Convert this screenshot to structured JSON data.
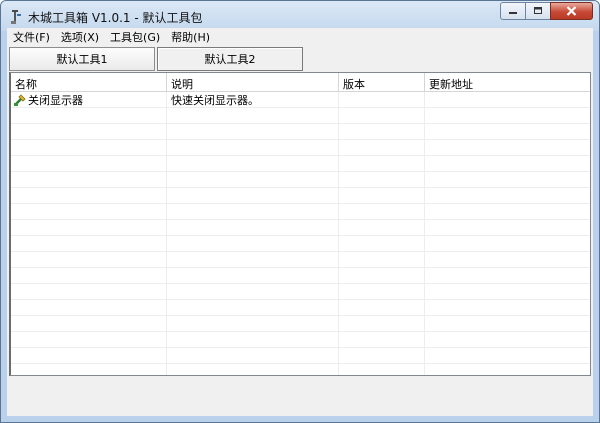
{
  "window": {
    "title": "木城工具箱 V1.0.1 - 默认工具包",
    "app_icon": "toolbox-icon",
    "caption_buttons": [
      "minimize-icon",
      "maximize-icon",
      "close-icon"
    ],
    "close_color": "#c74a36"
  },
  "menu": {
    "items": [
      {
        "label": "文件(F)"
      },
      {
        "label": "选项(X)"
      },
      {
        "label": "工具包(G)"
      },
      {
        "label": "帮助(H)"
      }
    ]
  },
  "tabs": [
    {
      "label": "默认工具1",
      "selected": false
    },
    {
      "label": "默认工具2",
      "selected": true
    }
  ],
  "list": {
    "columns": [
      "名称",
      "说明",
      "版本",
      "更新地址"
    ],
    "rows": [
      {
        "icon": "tool-icon",
        "name": "关闭显示器",
        "description": "快速关闭显示器。",
        "version": "",
        "update_url": ""
      }
    ]
  }
}
